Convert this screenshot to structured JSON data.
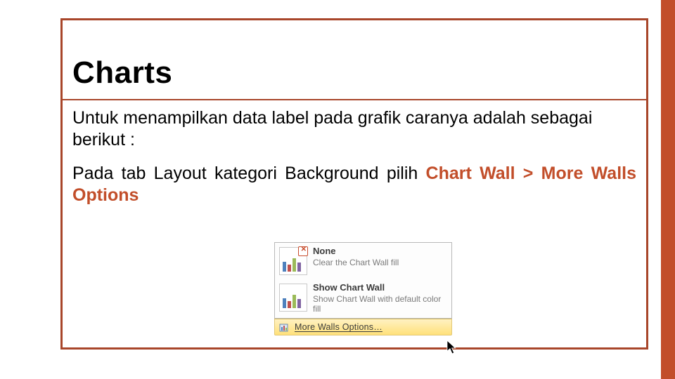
{
  "title": "Charts",
  "para1": "Untuk menampilkan data label pada grafik caranya adalah sebagai berikut :",
  "para2a": "Pada tab Layout kategori Background pilih ",
  "para2b": "Chart Wall > More Walls Options",
  "dropdown": {
    "none": {
      "title": "None",
      "desc": "Clear the Chart Wall fill"
    },
    "show": {
      "title": "Show Chart Wall",
      "desc": "Show Chart Wall with default color fill"
    },
    "more": "More Walls Options…"
  }
}
